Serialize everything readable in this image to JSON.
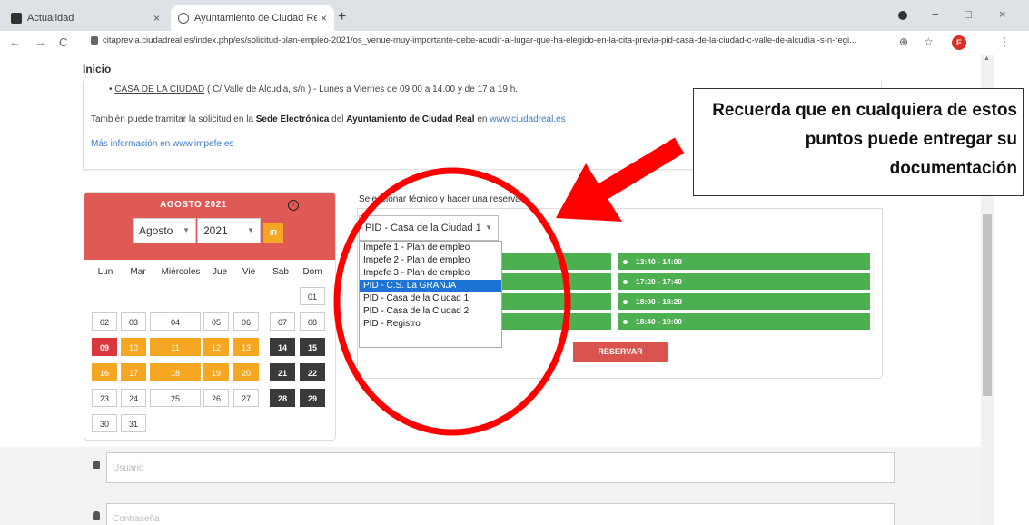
{
  "browser": {
    "tabs": [
      {
        "title": "Actualidad",
        "close": "×"
      },
      {
        "title": "Ayuntamiento de Ciudad Real",
        "close": "×"
      }
    ],
    "new_tab": "+",
    "url": "citaprevia.ciudadreal.es/index.php/es/solicitud-plan-empleo-2021/os_venue-muy-importante-debe-acudir-al-lugar-que-ha-elegido-en-la-cita-previa-pid-casa-de-la-ciudad-c-valle-de-alcudia,-s-n-regi...",
    "profile_initial": "E",
    "icons": {
      "back": "←",
      "forward": "→",
      "reload": "C",
      "zoom": "⊕",
      "star": "☆",
      "menu": "⋮",
      "minimize": "−",
      "maximize": "□",
      "close": "×"
    }
  },
  "page": {
    "home": "Inicio",
    "info": {
      "bullet_link": "CASA DE LA CIUDAD",
      "bullet_rest": " ( C/ Valle de Alcudia, s/n ) - Lunes a Viernes de 09.00 a 14.00 y de 17 a 19 h.",
      "line2_pre": "También puede tramitar la solicitud en la ",
      "line2_bold1": "Sede Electrónica",
      "line2_mid": " del ",
      "line2_bold2": "Ayuntamiento de Ciudad Real",
      "line2_en": " en ",
      "line2_link": "www.ciudadreal.es",
      "more_info": "Más información en www.impefe.es"
    },
    "calendar": {
      "title": "AGOSTO 2021",
      "month": "Agosto",
      "year": "2021",
      "go": "IR",
      "next_icon": "›",
      "weekdays": [
        "Lun",
        "Mar",
        "Miércoles",
        "Jue",
        "Vie",
        "Sab",
        "Dom"
      ],
      "weeks": [
        [
          "",
          "",
          "",
          "",
          "",
          "",
          "01"
        ],
        [
          "02",
          "03",
          "04",
          "05",
          "06",
          "07",
          "08"
        ],
        [
          "09",
          "10",
          "11",
          "12",
          "13",
          "14",
          "15"
        ],
        [
          "16",
          "17",
          "18",
          "19",
          "20",
          "21",
          "22"
        ],
        [
          "23",
          "24",
          "25",
          "26",
          "27",
          "28",
          "29"
        ],
        [
          "30",
          "31",
          "",
          "",
          "",
          "",
          ""
        ]
      ]
    },
    "reserve": {
      "label": "Seleccionar técnico y hacer una reserva",
      "selected": "PID - Casa de la Ciudad 1",
      "options": [
        "Impefe 1 - Plan de empleo",
        "Impefe 2 - Plan de empleo",
        "Impefe 3 - Plan de empleo",
        "PID - C.S. La GRANJA",
        "PID - Casa de la Ciudad 1",
        "PID - Casa de la Ciudad 2",
        "PID - Registro"
      ],
      "highlighted_option": "PID - C.S. La GRANJA",
      "slots": [
        "13:40 - 14:00",
        "17:20 - 17:40",
        "18:00 - 18:20",
        "18:40 - 19:00"
      ],
      "button": "RESERVAR"
    },
    "login": {
      "user_placeholder": "Usuario",
      "password_placeholder": "Contraseña"
    }
  },
  "annotation": {
    "callout": "Recuerda que en cualquiera de estos puntos puede entregar su documentación",
    "color": "#ff0000"
  },
  "colors": {
    "calendar_header": "#e05a55",
    "orange": "#f5a623",
    "dark_day": "#3a3a3a",
    "slot_green": "#4caf50",
    "reserve_button": "#d9534f",
    "highlight": "#1e74d4"
  }
}
